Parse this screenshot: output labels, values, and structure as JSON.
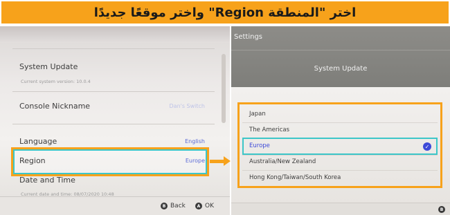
{
  "banner": {
    "title": "اختر \"المنطقة Region\" واختر موقعًا جديدًا"
  },
  "left_panel": {
    "items": [
      {
        "label": "System Update",
        "sub": "Current system version: 10.0.4"
      },
      {
        "label": "Console Nickname",
        "value": "Dan's Switch"
      },
      {
        "label": "Language",
        "value": "English"
      },
      {
        "label": "Region",
        "value": "Europe"
      },
      {
        "label": "Date and Time",
        "sub": "Current date and time: 08/07/2020 10:48"
      }
    ],
    "footer": {
      "back_key": "B",
      "back_label": "Back",
      "ok_key": "A",
      "ok_label": "OK"
    }
  },
  "right_panel": {
    "header_title": "Settings",
    "header_item": "System Update",
    "options": [
      "Japan",
      "The Americas",
      "Europe",
      "Australia/New Zealand",
      "Hong Kong/Taiwan/South Korea"
    ],
    "selected_index": 2,
    "footer_key": "B"
  },
  "colors": {
    "accent_orange": "#f7a21b",
    "highlight_teal": "#3cc6c8",
    "value_blue": "#5b6bd6",
    "check_blue": "#3d4ad8"
  }
}
